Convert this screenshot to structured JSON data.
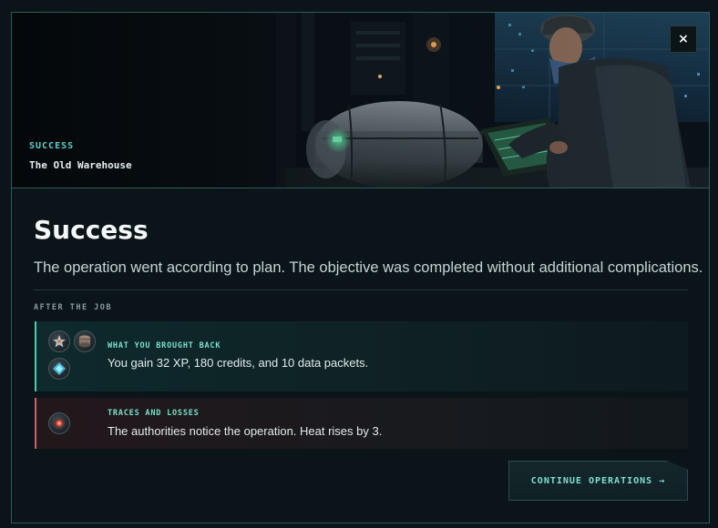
{
  "banner": {
    "label": "SUCCESS",
    "location": "The Old Warehouse",
    "close_label": "×"
  },
  "result": {
    "title": "Success",
    "description": "The operation went according to plan. The objective was completed without additional complications."
  },
  "after_job": {
    "section_label": "AFTER THE JOB",
    "gains": {
      "heading": "WHAT YOU BROUGHT BACK",
      "text": "You gain 32 XP, 180 credits, and 10 data packets.",
      "icons": [
        "xp-star-icon",
        "credits-coin-icon",
        "data-packet-icon"
      ]
    },
    "losses": {
      "heading": "TRACES AND LOSSES",
      "text": "The authorities notice the operation. Heat rises by 3.",
      "icons": [
        "heat-alarm-icon"
      ]
    }
  },
  "actions": {
    "continue_label": "CONTINUE OPERATIONS",
    "continue_arrow": "→"
  },
  "colors": {
    "accent": "#5fd0c7",
    "gain_border": "#4fc9b0",
    "loss_border": "#c86468",
    "background": "#0b1519"
  }
}
